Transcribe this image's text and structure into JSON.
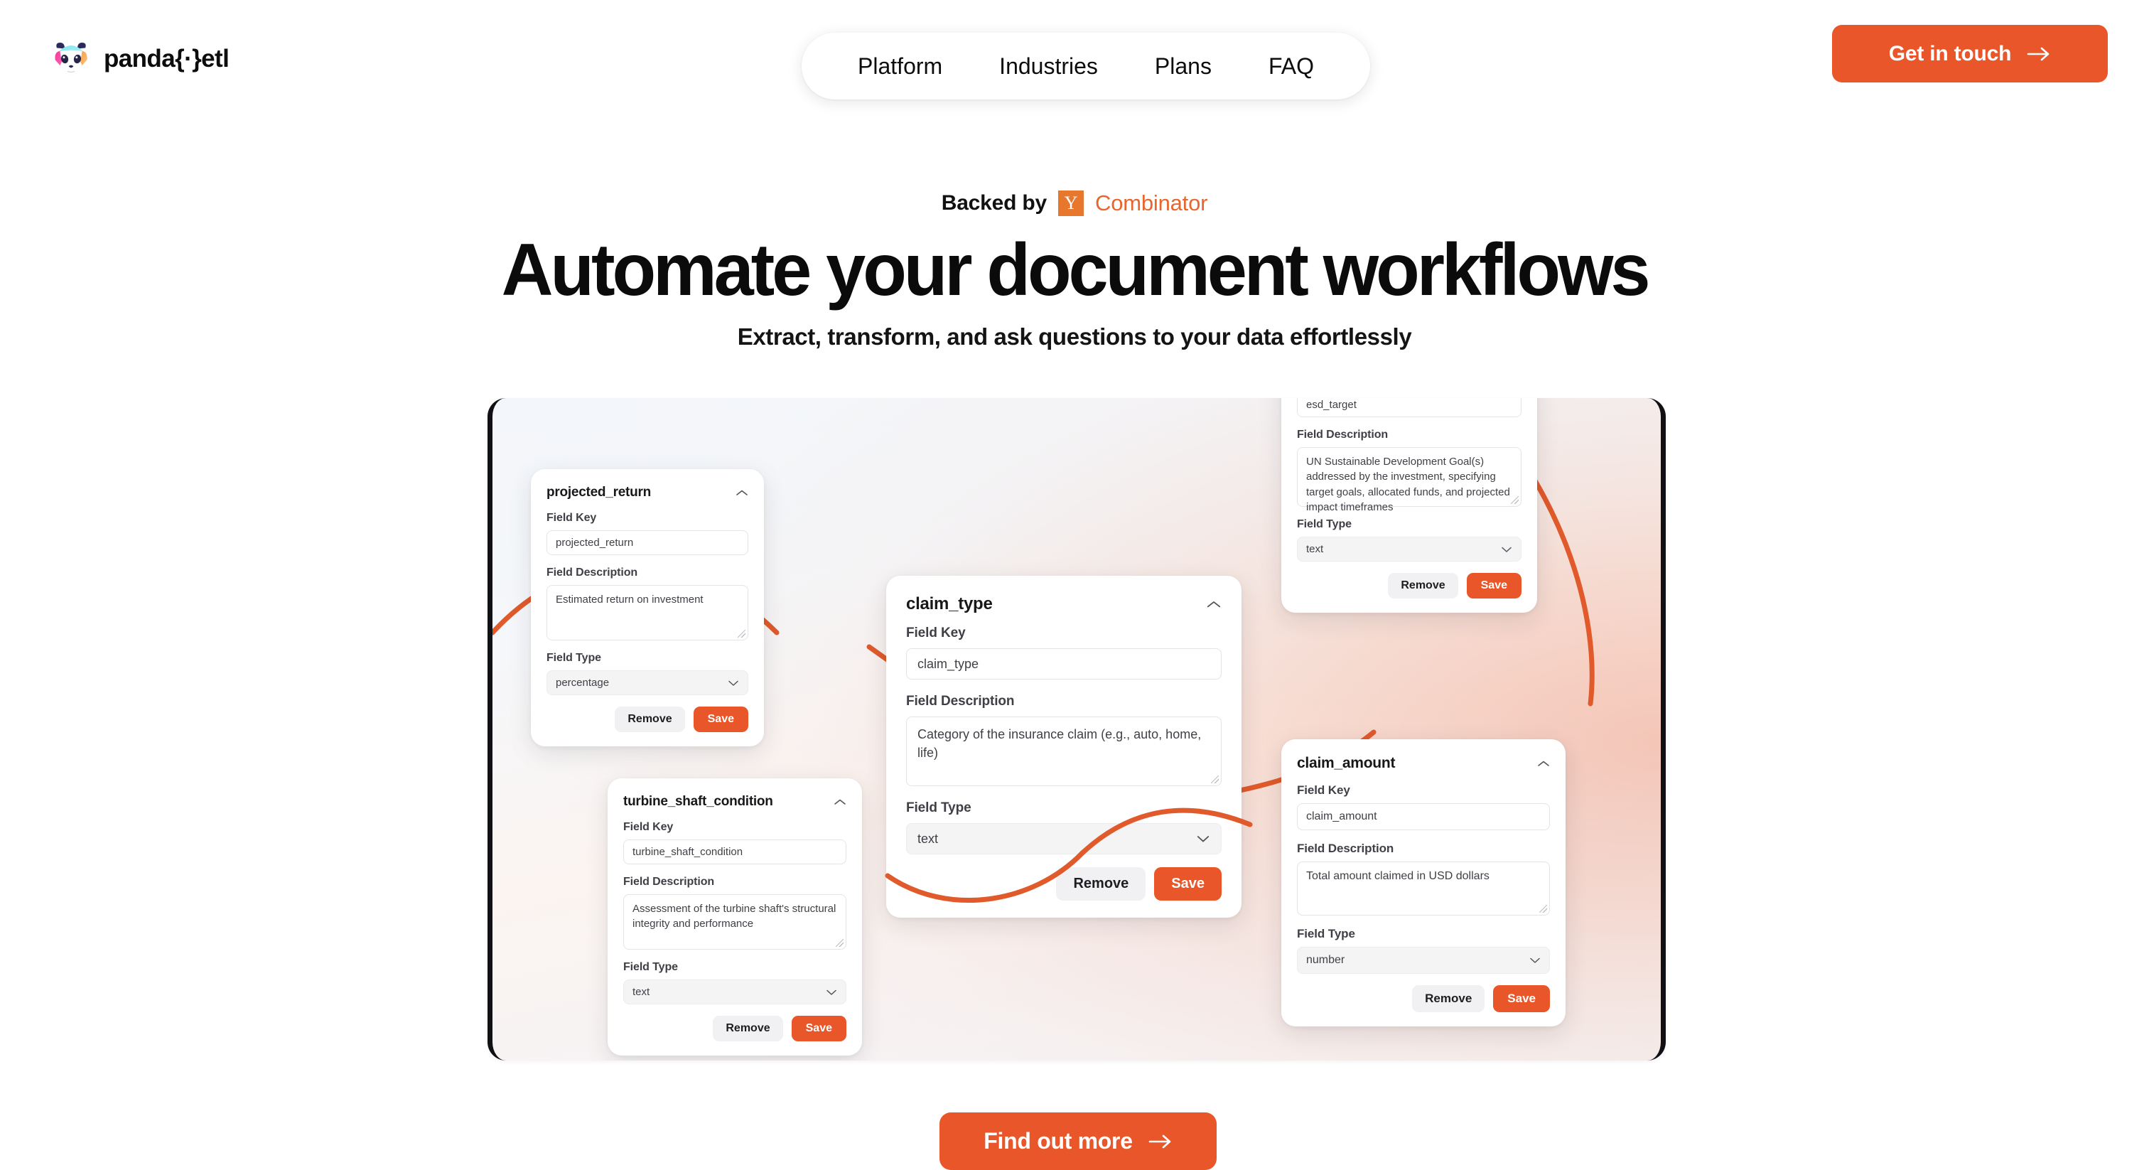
{
  "header": {
    "brand_name": "panda{·}etl",
    "logo_icon": "panda-logo-icon",
    "nav": [
      {
        "label": "Platform"
      },
      {
        "label": "Industries"
      },
      {
        "label": "Plans"
      },
      {
        "label": "FAQ"
      }
    ],
    "cta": {
      "label": "Get in touch",
      "icon": "arrow-right-icon"
    }
  },
  "hero": {
    "backed_prefix": "Backed by",
    "yc_badge_letter": "Y",
    "yc_name": "Combinator",
    "headline": "Automate your document workflows",
    "subheadline": "Extract, transform, and ask questions to your data effortlessly"
  },
  "labels": {
    "field_key": "Field Key",
    "field_description": "Field Description",
    "field_type": "Field Type",
    "remove": "Remove",
    "save": "Save",
    "collapse_icon": "chevron-up-icon",
    "dropdown_icon": "chevron-down-icon"
  },
  "cards": [
    {
      "id": "projected",
      "title": "projected_return",
      "key_value": "projected_return",
      "description_value": "Estimated return on investment",
      "type_value": "percentage"
    },
    {
      "id": "turbine",
      "title": "turbine_shaft_condition",
      "key_value": "turbine_shaft_condition",
      "description_value": "Assessment of the turbine shaft's structural integrity and performance",
      "type_value": "text"
    },
    {
      "id": "claimtype",
      "title": "claim_type",
      "key_value": "claim_type",
      "description_value": "Category of the insurance claim (e.g., auto, home, life)",
      "type_value": "text"
    },
    {
      "id": "esd",
      "title": "esd_target",
      "key_value": "esd_target",
      "description_value": "UN Sustainable Development Goal(s) addressed by the investment, specifying target goals, allocated funds, and projected impact timeframes",
      "type_value": "text"
    },
    {
      "id": "claimamount",
      "title": "claim_amount",
      "key_value": "claim_amount",
      "description_value": "Total amount claimed in USD dollars",
      "type_value": "number"
    }
  ],
  "footer_cta": {
    "label": "Find out more",
    "icon": "arrow-right-icon"
  },
  "colors": {
    "accent_orange": "#E8562A",
    "yc_orange": "#E8772E",
    "text_dark": "#0d0d0d",
    "frame_border": "#111115"
  }
}
